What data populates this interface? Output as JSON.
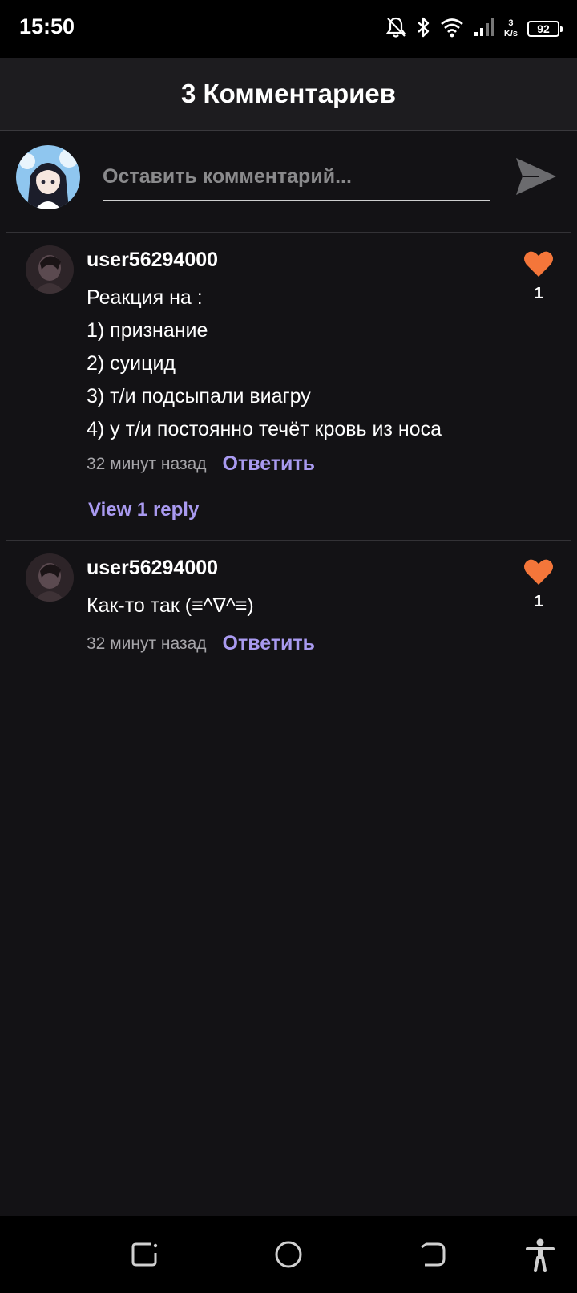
{
  "status_bar": {
    "time": "15:50",
    "net_speed_value": "3",
    "net_speed_unit": "K/s",
    "battery": "92",
    "icons": [
      "bell-off-icon",
      "bluetooth-icon",
      "wifi-icon",
      "signal-icon"
    ]
  },
  "header": {
    "title": "3 Комментариев"
  },
  "compose": {
    "placeholder": "Оставить комментарий...",
    "value": "",
    "send_icon": "send-icon"
  },
  "comments": [
    {
      "username": "user56294000",
      "lines": [
        "Реакция на :",
        "1) признание",
        "2) суицид",
        "3) т/и подсыпали виагру",
        "4) у т/и постоянно течёт кровь из носа"
      ],
      "time": "32 минут назад",
      "reply_label": "Ответить",
      "likes": "1",
      "view_replies": "View 1 reply"
    },
    {
      "username": "user56294000",
      "lines": [
        "Как-то так (≡^∇^≡)"
      ],
      "time": "32 минут назад",
      "reply_label": "Ответить",
      "likes": "1"
    }
  ],
  "colors": {
    "background": "#131215",
    "header": "#1d1c1f",
    "accent_link": "#a99af0",
    "heart": "#f4763a",
    "muted_text": "#a7a6aa"
  },
  "nav_bar": {
    "icons": [
      "recent-apps-icon",
      "home-icon",
      "back-icon",
      "accessibility-icon"
    ]
  }
}
